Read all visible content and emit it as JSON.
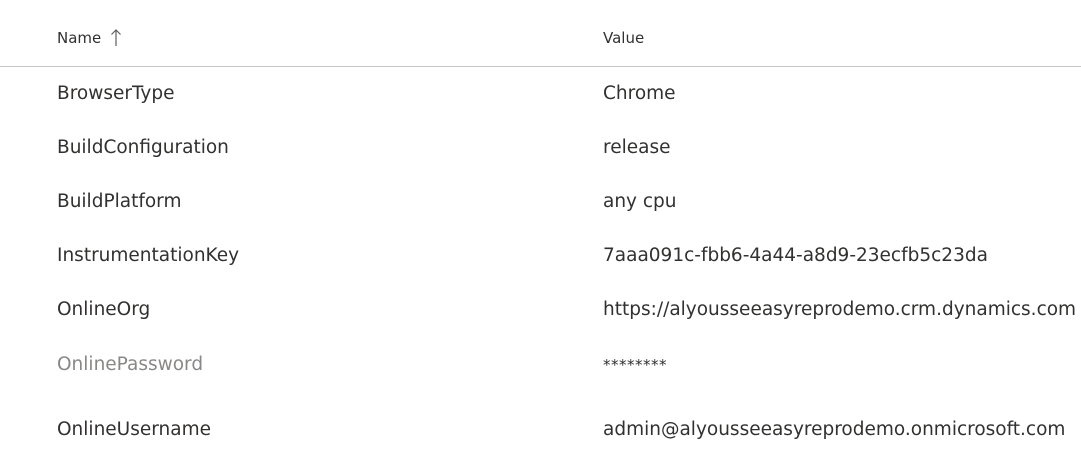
{
  "header": {
    "name_label": "Name",
    "value_label": "Value",
    "sort_icon": "arrow-up-icon"
  },
  "rows": [
    {
      "name": "BrowserType",
      "value": "Chrome"
    },
    {
      "name": "BuildConfiguration",
      "value": "release"
    },
    {
      "name": "BuildPlatform",
      "value": "any cpu"
    },
    {
      "name": "InstrumentationKey",
      "value": "7aaa091c-fbb6-4a44-a8d9-23ecfb5c23da"
    },
    {
      "name": "OnlineOrg",
      "value": "https://alyousseeasyreprodemo.crm.dynamics.com"
    },
    {
      "name": "OnlinePassword",
      "value": "********"
    },
    {
      "name": "OnlineUsername",
      "value": "admin@alyousseeasyreprodemo.onmicrosoft.com"
    }
  ]
}
